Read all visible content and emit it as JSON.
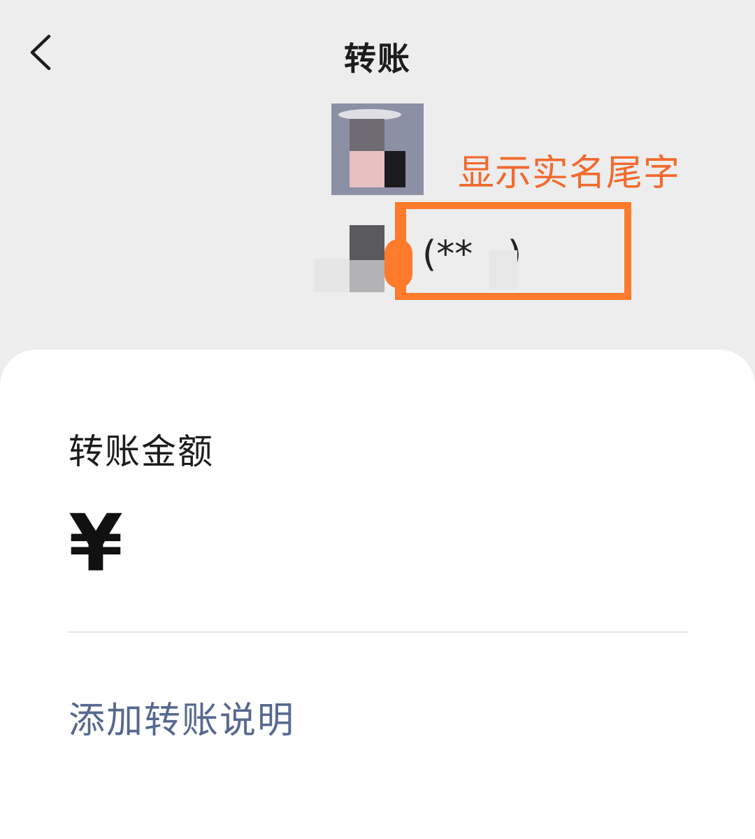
{
  "header": {
    "title": "转账",
    "back_icon": "chevron-left-icon"
  },
  "recipient": {
    "masked_name": "(**   )"
  },
  "annotation": {
    "label": "显示实名尾字",
    "color": "#ff7a2b"
  },
  "amount": {
    "label": "转账金额",
    "currency_symbol": "¥",
    "value": ""
  },
  "note": {
    "link_label": "添加转账说明"
  },
  "colors": {
    "background": "#ededed",
    "sheet": "#ffffff",
    "link": "#56688f"
  }
}
